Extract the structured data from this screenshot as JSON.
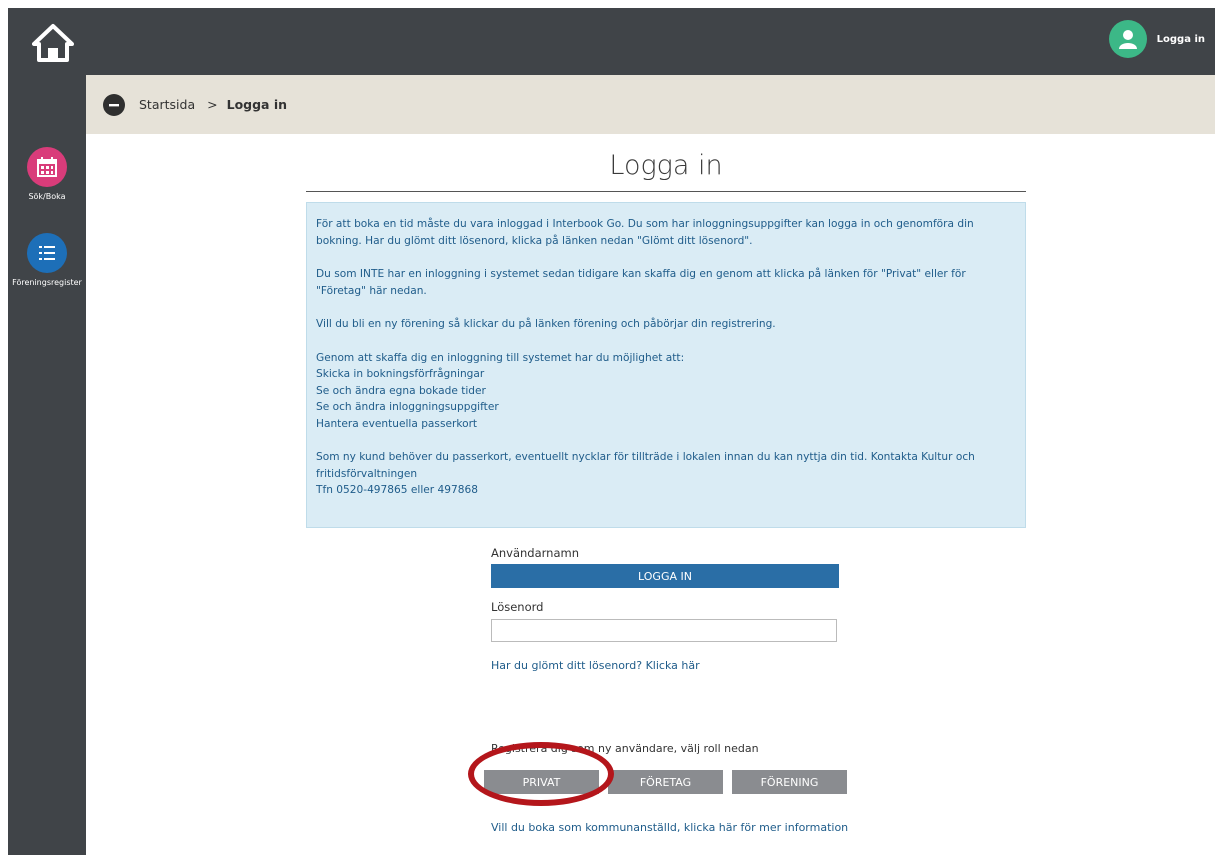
{
  "header": {
    "home_icon": "home-icon",
    "user_icon": "user-icon",
    "login_label": "Logga in"
  },
  "sidebar": {
    "items": [
      {
        "label": "Sök/Boka",
        "icon": "calendar-icon",
        "color": "#d93c7a"
      },
      {
        "label": "Föreningsregister",
        "icon": "list-icon",
        "color": "#1d6fb8"
      }
    ]
  },
  "breadcrumb": {
    "back_icon": "back-arrow-icon",
    "home": "Startsida",
    "separator": ">",
    "current": "Logga in"
  },
  "page": {
    "title": "Logga in"
  },
  "info": {
    "p1": "För att boka en tid måste du vara inloggad i Interbook Go. Du som har inloggningsuppgifter kan logga in och genomföra din bokning. Har du glömt ditt lösenord, klicka på länken nedan \"Glömt ditt lösenord\".",
    "p2": "Du som INTE har en inloggning i systemet sedan tidigare kan skaffa dig en genom att klicka på länken för \"Privat\" eller för \"Företag\" här nedan.",
    "p3": "Vill du bli en ny förening så klickar du på länken förening och påbörjar din registrering.",
    "p4_intro": "Genom att skaffa dig en inloggning till systemet har du möjlighet att:",
    "p4_items": [
      "Skicka in bokningsförfrågningar",
      "Se och ändra egna bokade tider",
      "Se och ändra inloggningsuppgifter",
      "Hantera eventuella passerkort"
    ],
    "p5": "Som ny kund behöver du passerkort, eventuellt nycklar för tillträde i lokalen innan du kan nyttja din tid. Kontakta Kultur och fritidsförvaltningen",
    "p5_phone": "Tfn 0520-497865 eller 497868"
  },
  "form": {
    "username_label": "Användarnamn",
    "username_value": "",
    "password_label": "Lösenord",
    "password_value": "",
    "forgot_link": "Har du glömt ditt lösenord? Klicka här",
    "login_button": "LOGGA IN"
  },
  "register": {
    "text": "Registrera dig som ny användare, välj roll nedan",
    "roles": [
      "PRIVAT",
      "FÖRETAG",
      "FÖRENING"
    ],
    "kommun_link": "Vill du boka som kommunanställd, klicka här för mer information"
  },
  "colors": {
    "topbar": "#404448",
    "accent_blue": "#2a6ea6",
    "info_bg": "#daecf5",
    "highlight_red": "#b4161b"
  }
}
